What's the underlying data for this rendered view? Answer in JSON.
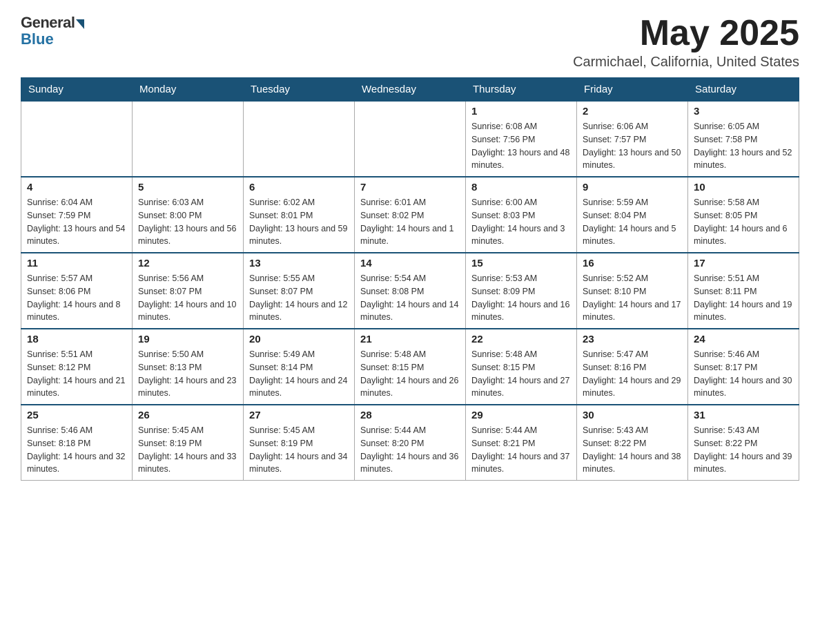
{
  "header": {
    "logo_general": "General",
    "logo_blue": "Blue",
    "month_year": "May 2025",
    "location": "Carmichael, California, United States"
  },
  "days_of_week": [
    "Sunday",
    "Monday",
    "Tuesday",
    "Wednesday",
    "Thursday",
    "Friday",
    "Saturday"
  ],
  "weeks": [
    [
      {
        "day": "",
        "info": ""
      },
      {
        "day": "",
        "info": ""
      },
      {
        "day": "",
        "info": ""
      },
      {
        "day": "",
        "info": ""
      },
      {
        "day": "1",
        "info": "Sunrise: 6:08 AM\nSunset: 7:56 PM\nDaylight: 13 hours and 48 minutes."
      },
      {
        "day": "2",
        "info": "Sunrise: 6:06 AM\nSunset: 7:57 PM\nDaylight: 13 hours and 50 minutes."
      },
      {
        "day": "3",
        "info": "Sunrise: 6:05 AM\nSunset: 7:58 PM\nDaylight: 13 hours and 52 minutes."
      }
    ],
    [
      {
        "day": "4",
        "info": "Sunrise: 6:04 AM\nSunset: 7:59 PM\nDaylight: 13 hours and 54 minutes."
      },
      {
        "day": "5",
        "info": "Sunrise: 6:03 AM\nSunset: 8:00 PM\nDaylight: 13 hours and 56 minutes."
      },
      {
        "day": "6",
        "info": "Sunrise: 6:02 AM\nSunset: 8:01 PM\nDaylight: 13 hours and 59 minutes."
      },
      {
        "day": "7",
        "info": "Sunrise: 6:01 AM\nSunset: 8:02 PM\nDaylight: 14 hours and 1 minute."
      },
      {
        "day": "8",
        "info": "Sunrise: 6:00 AM\nSunset: 8:03 PM\nDaylight: 14 hours and 3 minutes."
      },
      {
        "day": "9",
        "info": "Sunrise: 5:59 AM\nSunset: 8:04 PM\nDaylight: 14 hours and 5 minutes."
      },
      {
        "day": "10",
        "info": "Sunrise: 5:58 AM\nSunset: 8:05 PM\nDaylight: 14 hours and 6 minutes."
      }
    ],
    [
      {
        "day": "11",
        "info": "Sunrise: 5:57 AM\nSunset: 8:06 PM\nDaylight: 14 hours and 8 minutes."
      },
      {
        "day": "12",
        "info": "Sunrise: 5:56 AM\nSunset: 8:07 PM\nDaylight: 14 hours and 10 minutes."
      },
      {
        "day": "13",
        "info": "Sunrise: 5:55 AM\nSunset: 8:07 PM\nDaylight: 14 hours and 12 minutes."
      },
      {
        "day": "14",
        "info": "Sunrise: 5:54 AM\nSunset: 8:08 PM\nDaylight: 14 hours and 14 minutes."
      },
      {
        "day": "15",
        "info": "Sunrise: 5:53 AM\nSunset: 8:09 PM\nDaylight: 14 hours and 16 minutes."
      },
      {
        "day": "16",
        "info": "Sunrise: 5:52 AM\nSunset: 8:10 PM\nDaylight: 14 hours and 17 minutes."
      },
      {
        "day": "17",
        "info": "Sunrise: 5:51 AM\nSunset: 8:11 PM\nDaylight: 14 hours and 19 minutes."
      }
    ],
    [
      {
        "day": "18",
        "info": "Sunrise: 5:51 AM\nSunset: 8:12 PM\nDaylight: 14 hours and 21 minutes."
      },
      {
        "day": "19",
        "info": "Sunrise: 5:50 AM\nSunset: 8:13 PM\nDaylight: 14 hours and 23 minutes."
      },
      {
        "day": "20",
        "info": "Sunrise: 5:49 AM\nSunset: 8:14 PM\nDaylight: 14 hours and 24 minutes."
      },
      {
        "day": "21",
        "info": "Sunrise: 5:48 AM\nSunset: 8:15 PM\nDaylight: 14 hours and 26 minutes."
      },
      {
        "day": "22",
        "info": "Sunrise: 5:48 AM\nSunset: 8:15 PM\nDaylight: 14 hours and 27 minutes."
      },
      {
        "day": "23",
        "info": "Sunrise: 5:47 AM\nSunset: 8:16 PM\nDaylight: 14 hours and 29 minutes."
      },
      {
        "day": "24",
        "info": "Sunrise: 5:46 AM\nSunset: 8:17 PM\nDaylight: 14 hours and 30 minutes."
      }
    ],
    [
      {
        "day": "25",
        "info": "Sunrise: 5:46 AM\nSunset: 8:18 PM\nDaylight: 14 hours and 32 minutes."
      },
      {
        "day": "26",
        "info": "Sunrise: 5:45 AM\nSunset: 8:19 PM\nDaylight: 14 hours and 33 minutes."
      },
      {
        "day": "27",
        "info": "Sunrise: 5:45 AM\nSunset: 8:19 PM\nDaylight: 14 hours and 34 minutes."
      },
      {
        "day": "28",
        "info": "Sunrise: 5:44 AM\nSunset: 8:20 PM\nDaylight: 14 hours and 36 minutes."
      },
      {
        "day": "29",
        "info": "Sunrise: 5:44 AM\nSunset: 8:21 PM\nDaylight: 14 hours and 37 minutes."
      },
      {
        "day": "30",
        "info": "Sunrise: 5:43 AM\nSunset: 8:22 PM\nDaylight: 14 hours and 38 minutes."
      },
      {
        "day": "31",
        "info": "Sunrise: 5:43 AM\nSunset: 8:22 PM\nDaylight: 14 hours and 39 minutes."
      }
    ]
  ]
}
